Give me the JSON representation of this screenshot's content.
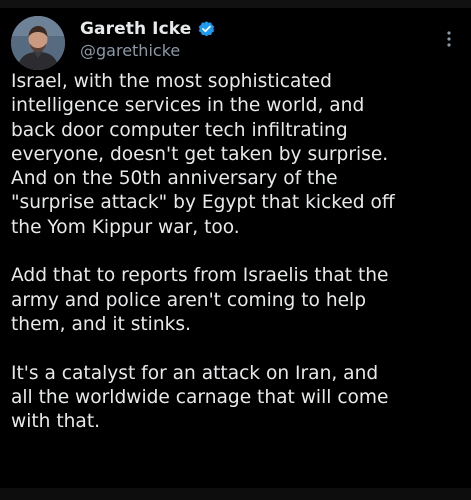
{
  "tweet": {
    "author": {
      "name": "Gareth Icke",
      "handle": "@garethicke",
      "verified": true,
      "verified_color": "#1d9bf0"
    },
    "more_icon": "more-vertical-icon",
    "paragraphs": [
      "Israel, with the most sophisticated\nintelligence services in the world, and\nback door computer tech infiltrating\neveryone, doesn't get taken by surprise.\nAnd on the 50th anniversary of the\n\"surprise attack\" by Egypt that kicked off\nthe Yom Kippur war, too.",
      "Add that to reports from Israelis that the\narmy and police aren't coming to help\nthem, and it stinks.",
      "It's a catalyst for an attack on Iran, and\nall the worldwide carnage that will come\nwith that."
    ]
  },
  "colors": {
    "background": "#000000",
    "text": "#e7e9ea",
    "secondary_text": "#8b98a5"
  }
}
